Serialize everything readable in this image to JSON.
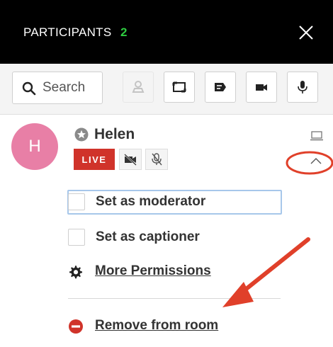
{
  "header": {
    "title": "PARTICIPANTS",
    "count": "2"
  },
  "search": {
    "placeholder": "Search"
  },
  "toolbar": {
    "buttons": [
      {
        "icon": "seat-icon",
        "disabled": true
      },
      {
        "icon": "expand-screen-icon",
        "disabled": false
      },
      {
        "icon": "caption-icon",
        "disabled": false
      },
      {
        "icon": "video-camera-icon",
        "disabled": false
      },
      {
        "icon": "microphone-icon",
        "disabled": false
      }
    ]
  },
  "participant": {
    "initial": "H",
    "name": "Helen",
    "badge": "LIVE",
    "avatar_color": "#e87fa6",
    "badge_color": "#d0332a"
  },
  "menu": {
    "moderator_label": "Set as moderator",
    "captioner_label": "Set as captioner",
    "permissions_label": "More Permissions",
    "remove_label": "Remove from room"
  },
  "colors": {
    "accent_green": "#2ecc40",
    "annotation_red": "#e0402a"
  }
}
